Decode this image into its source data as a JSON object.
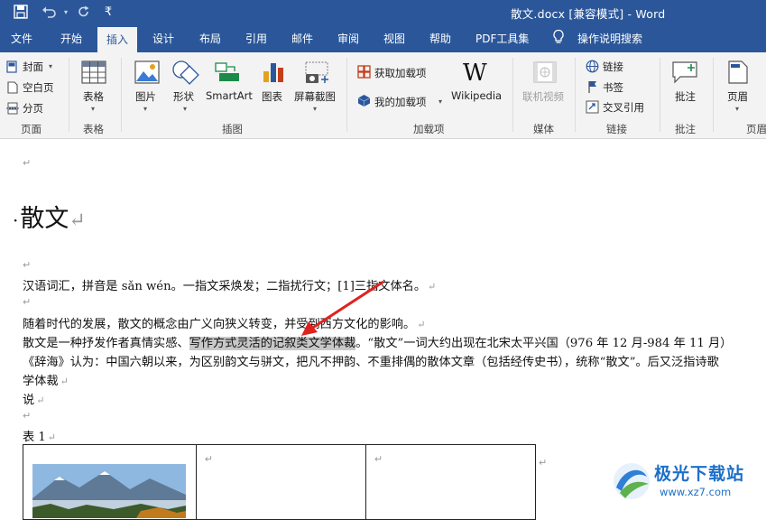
{
  "window": {
    "title": "散文.docx [兼容模式]  -  Word"
  },
  "quick_access": {
    "save_icon": "save-icon",
    "undo_icon": "undo-icon",
    "redo_icon": "redo-icon",
    "customize": "₹"
  },
  "tabs": [
    "文件",
    "开始",
    "插入",
    "设计",
    "布局",
    "引用",
    "邮件",
    "审阅",
    "视图",
    "帮助",
    "PDF工具集",
    "操作说明搜索"
  ],
  "active_tab": "插入",
  "ribbon": {
    "pages": {
      "cover": "封面",
      "blank": "空白页",
      "break": "分页",
      "group": "页面"
    },
    "tables": {
      "table": "表格",
      "group": "表格"
    },
    "illustrations": {
      "picture": "图片",
      "shapes": "形状",
      "smartart": "SmartArt",
      "chart": "图表",
      "screenshot": "屏幕截图",
      "group": "插图"
    },
    "addins": {
      "get": "获取加载项",
      "mine": "我的加载项",
      "wikipedia": "Wikipedia",
      "group": "加载项"
    },
    "media": {
      "online_video": "联机视频",
      "group": "媒体"
    },
    "links": {
      "link": "链接",
      "bookmark": "书签",
      "crossref": "交叉引用",
      "group": "链接"
    },
    "comments": {
      "comment": "批注",
      "group": "批注"
    },
    "header_footer": {
      "header": "页眉",
      "group": "页眉"
    }
  },
  "document": {
    "heading": "散文",
    "para1": "汉语词汇，拼音是 sǎn wén。一指文采焕发；二指扰行文；[1]三指文体名。",
    "para2": "随着时代的发展，散文的概念由广义向狭义转变，并受到西方文化的影响。",
    "para3_a": "散文是一种抒发作者真情实感、",
    "para3_hl": "写作方式灵活的记叙类文学体裁",
    "para3_b": "。“散文”一词大约出现在北宋太平兴国（976 年 12 月-984 年 11 月）",
    "para4": "《辞海》认为：中国六朝以来，为区别韵文与骈文，把凡不押韵、不重排偶的散体文章（包括经传史书），统称“散文”。后又泛指诗歌",
    "para5": "学体裁",
    "para6": "说",
    "caption": "表  1"
  },
  "watermark": {
    "name": "极光下载站",
    "url": "www.xz7.com"
  },
  "colors": {
    "title_bar": "#2b579a",
    "ribbon_bg": "#f3f3f3",
    "arrow": "#e0221f"
  }
}
